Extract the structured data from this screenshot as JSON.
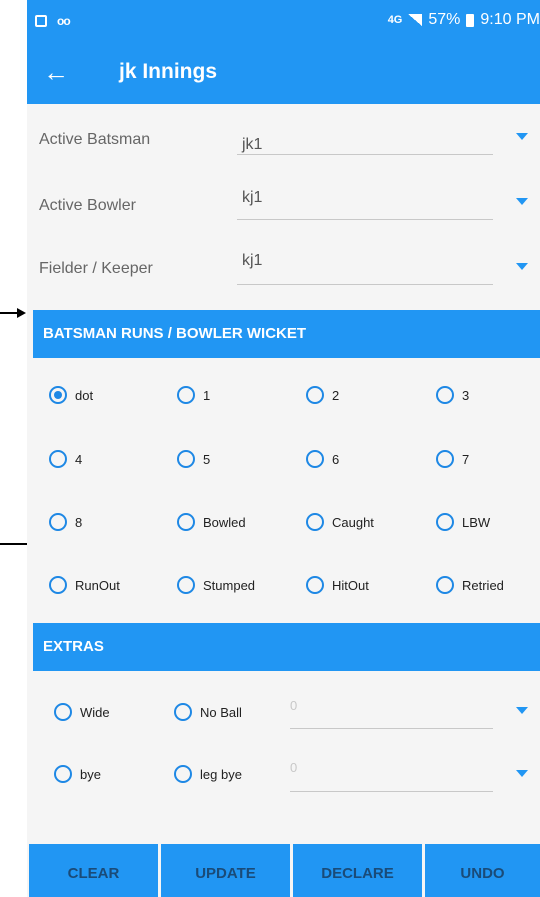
{
  "status_bar": {
    "network": "4G",
    "battery": "57%",
    "time": "9:10 PM"
  },
  "app_bar": {
    "title": "jk Innings"
  },
  "fields": [
    {
      "label": "Active Batsman",
      "value": "jk1"
    },
    {
      "label": "Active Bowler",
      "value": "kj1"
    },
    {
      "label": "Fielder / Keeper",
      "value": "kj1"
    }
  ],
  "runs_section": {
    "header": "BATSMAN RUNS / BOWLER WICKET",
    "options": [
      "dot",
      "1",
      "2",
      "3",
      "4",
      "5",
      "6",
      "7",
      "8",
      "Bowled",
      "Caught",
      "LBW",
      "RunOut",
      "Stumped",
      "HitOut",
      "Retried"
    ],
    "selected": "dot"
  },
  "extras_section": {
    "header": "EXTRAS",
    "options": [
      "Wide",
      "No Ball",
      "bye",
      "leg bye"
    ],
    "inputs": [
      "0",
      "0"
    ]
  },
  "buttons": [
    "CLEAR",
    "UPDATE",
    "DECLARE",
    "UNDO"
  ],
  "colors": {
    "primary": "#2196f3",
    "radio": "#1e88e5",
    "button_text": "#1a4b78"
  }
}
